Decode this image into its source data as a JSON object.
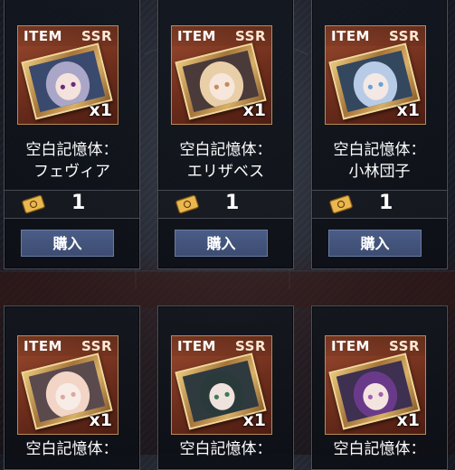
{
  "cards": [
    {
      "tag": "ITEM",
      "rarity": "SSR",
      "qty": "x1",
      "name_line1": "空白記憶体：",
      "name_line2": "フェヴィア",
      "price": "1",
      "buy_label": "購入",
      "hair": "#a9a6c8",
      "accent": "#6b2b7a"
    },
    {
      "tag": "ITEM",
      "rarity": "SSR",
      "qty": "x1",
      "name_line1": "空白記憶体：",
      "name_line2": "エリザベス",
      "price": "1",
      "buy_label": "購入",
      "hair": "#e8cfa8",
      "accent": "#c78a5a"
    },
    {
      "tag": "ITEM",
      "rarity": "SSR",
      "qty": "x1",
      "name_line1": "空白記憶体：",
      "name_line2": "小林団子",
      "price": "1",
      "buy_label": "購入",
      "hair": "#b7cbe6",
      "accent": "#6aa0d8"
    },
    {
      "tag": "ITEM",
      "rarity": "SSR",
      "qty": "x1",
      "name_line1": "空白記憶体：",
      "hair": "#f2d5c6",
      "accent": "#d9a9a0"
    },
    {
      "tag": "ITEM",
      "rarity": "SSR",
      "qty": "x1",
      "name_line1": "空白記憶体：",
      "hair": "#2a3a3a",
      "accent": "#3e7a5a"
    },
    {
      "tag": "ITEM",
      "rarity": "SSR",
      "qty": "x1",
      "name_line1": "空白記憶体：",
      "hair": "#6a3a8a",
      "accent": "#a060b0"
    }
  ],
  "icons": {
    "price_currency": "ticket-icon"
  }
}
